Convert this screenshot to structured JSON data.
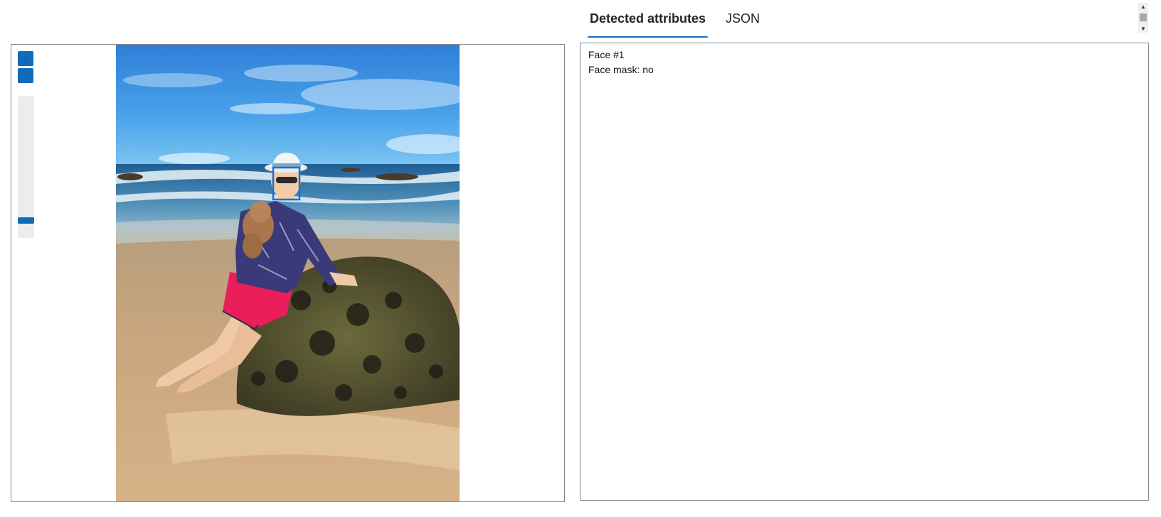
{
  "tabs": [
    {
      "label": "Detected attributes",
      "active": true
    },
    {
      "label": "JSON",
      "active": false
    }
  ],
  "viewer": {
    "zoom_in_label": "+",
    "zoom_out_label": "−",
    "zoom_level": 0.09
  },
  "results": {
    "lines": [
      "Face #1",
      "Face mask: no"
    ]
  },
  "colors": {
    "accent": "#0f6cbd",
    "face_box": "#1e6fd1"
  },
  "icons": {
    "zoom_in": "plus-icon",
    "zoom_out": "minus-icon",
    "scroll_up": "caret-up-icon",
    "scroll_down": "caret-down-icon"
  }
}
